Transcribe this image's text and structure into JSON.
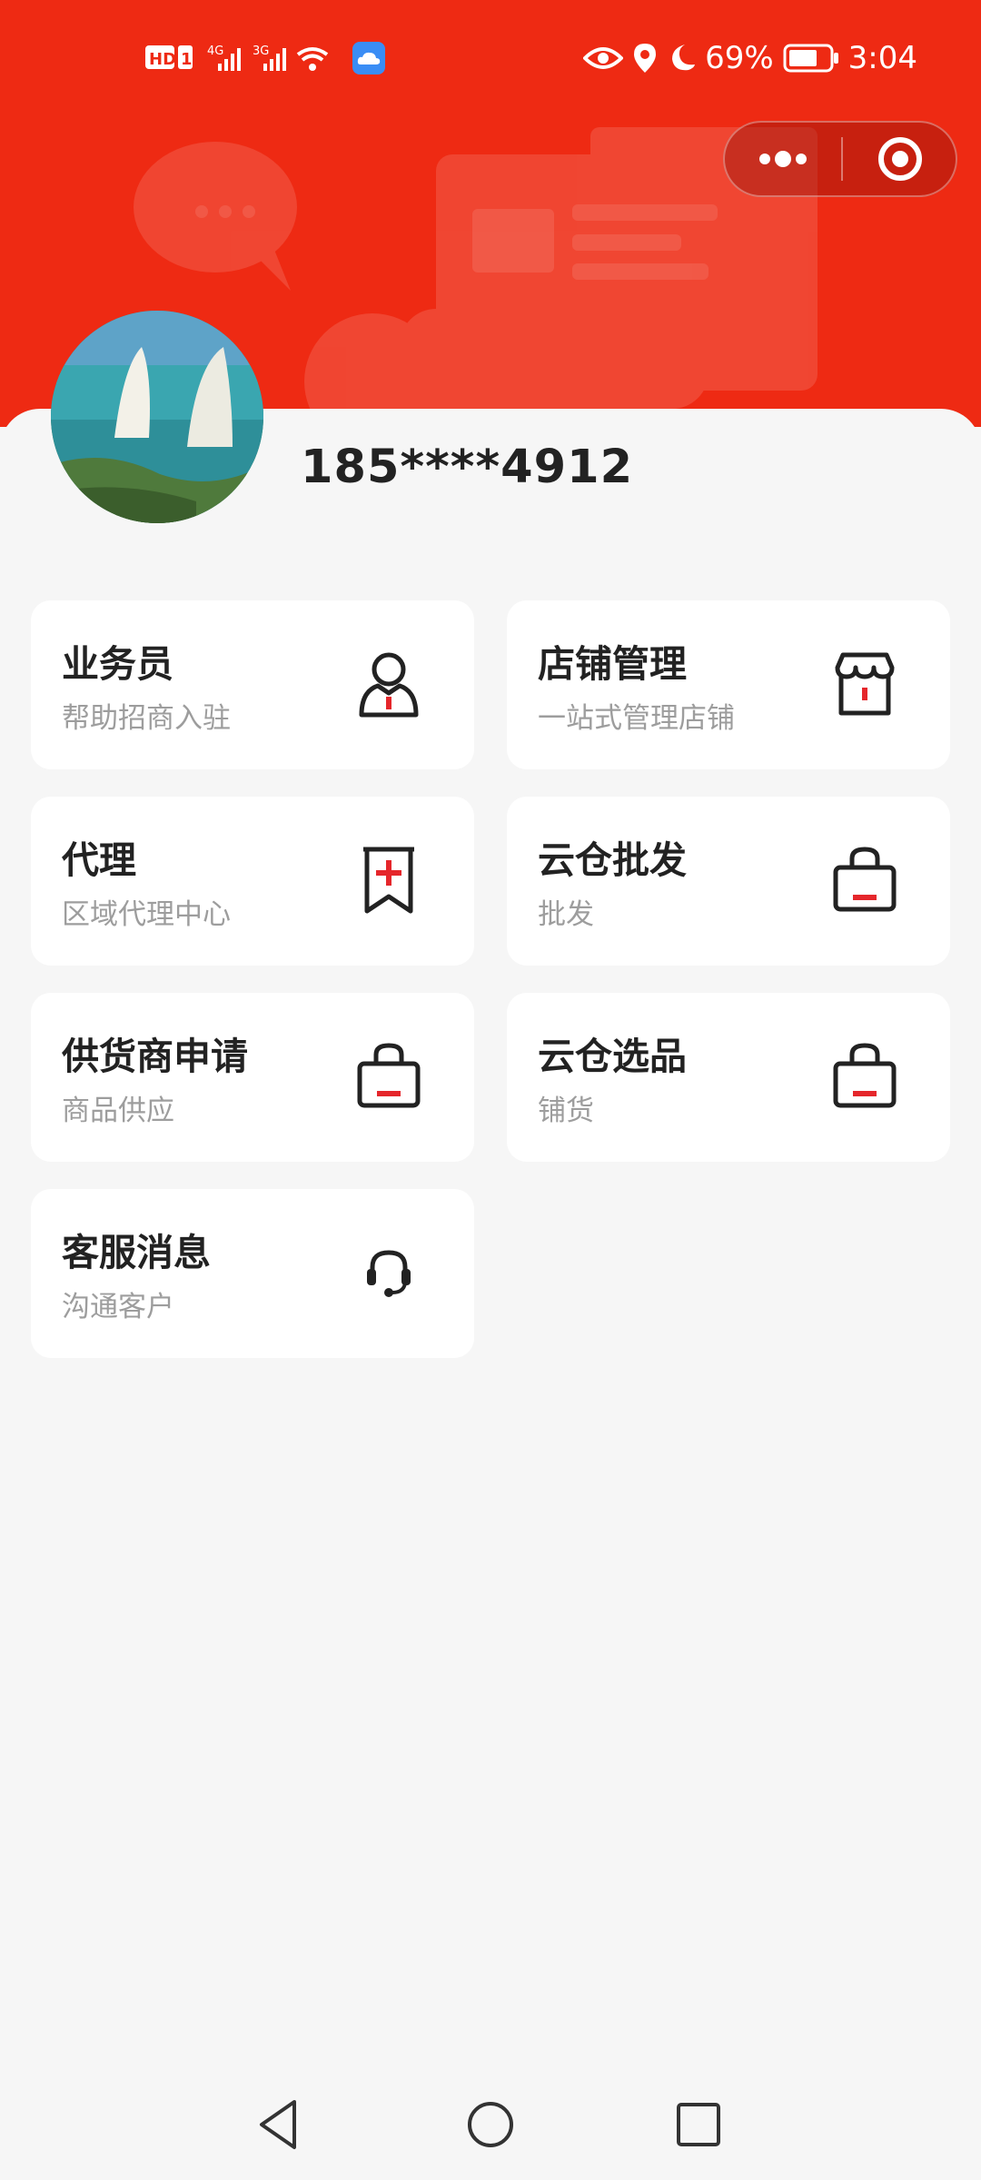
{
  "status_bar": {
    "left_indicators": "HD 1 4G 3G",
    "battery": "69%",
    "time": "3:04"
  },
  "user": {
    "phone": "185****4912"
  },
  "menu": [
    {
      "title": "业务员",
      "subtitle": "帮助招商入驻",
      "icon": "salesperson-icon"
    },
    {
      "title": "店铺管理",
      "subtitle": "一站式管理店铺",
      "icon": "store-icon"
    },
    {
      "title": "代理",
      "subtitle": "区域代理中心",
      "icon": "agent-bookmark-icon"
    },
    {
      "title": "云仓批发",
      "subtitle": "批发",
      "icon": "shopping-bag-icon"
    },
    {
      "title": "供货商申请",
      "subtitle": "商品供应",
      "icon": "shopping-bag-icon"
    },
    {
      "title": "云仓选品",
      "subtitle": "铺货",
      "icon": "shopping-bag-icon"
    },
    {
      "title": "客服消息",
      "subtitle": "沟通客户",
      "icon": "headset-icon"
    }
  ],
  "colors": {
    "brand": "#ee2a13",
    "accent": "#e5262b",
    "icon_stroke": "#222222",
    "subtitle": "#9d9d9d"
  }
}
